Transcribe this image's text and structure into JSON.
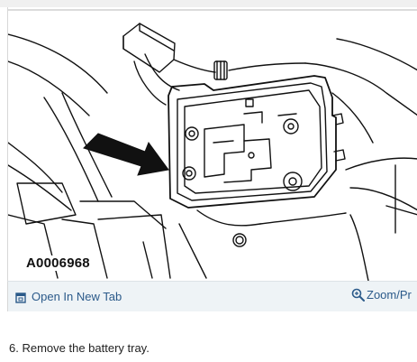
{
  "figure": {
    "id_label": "A0006968",
    "illustration_subject": "battery tray with four mounting bolts, arrow pointing to tray"
  },
  "actions": {
    "open_new_tab": "Open In New Tab",
    "zoom": "Zoom/Pr"
  },
  "instructions": {
    "step": "6. Remove the battery tray."
  },
  "colors": {
    "link": "#2b5a8a",
    "action_bar_bg": "#eef3f6"
  }
}
